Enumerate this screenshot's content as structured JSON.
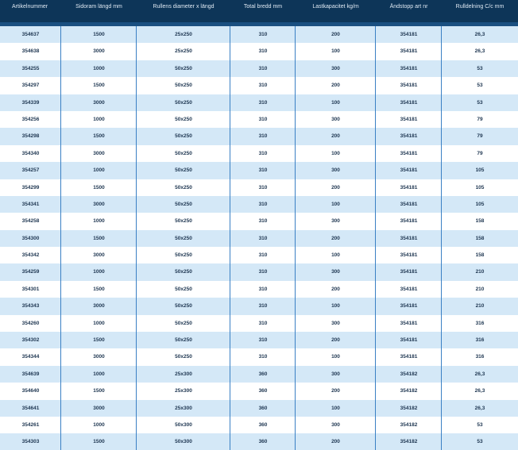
{
  "table": {
    "columns": [
      "Artikelnummer",
      "Sidoram längd mm",
      "Rullens diameter x längd",
      "Total bredd mm",
      "Lastkapacitet kg/m",
      "Ändstopp art nr",
      "Rulldelning C/c mm"
    ],
    "rows": [
      [
        "354637",
        "1500",
        "25x250",
        "310",
        "200",
        "354181",
        "26,3"
      ],
      [
        "354638",
        "3000",
        "25x250",
        "310",
        "100",
        "354181",
        "26,3"
      ],
      [
        "354255",
        "1000",
        "50x250",
        "310",
        "300",
        "354181",
        "53"
      ],
      [
        "354297",
        "1500",
        "50x250",
        "310",
        "200",
        "354181",
        "53"
      ],
      [
        "354339",
        "3000",
        "50x250",
        "310",
        "100",
        "354181",
        "53"
      ],
      [
        "354256",
        "1000",
        "50x250",
        "310",
        "300",
        "354181",
        "79"
      ],
      [
        "354298",
        "1500",
        "50x250",
        "310",
        "200",
        "354181",
        "79"
      ],
      [
        "354340",
        "3000",
        "50x250",
        "310",
        "100",
        "354181",
        "79"
      ],
      [
        "354257",
        "1000",
        "50x250",
        "310",
        "300",
        "354181",
        "105"
      ],
      [
        "354299",
        "1500",
        "50x250",
        "310",
        "200",
        "354181",
        "105"
      ],
      [
        "354341",
        "3000",
        "50x250",
        "310",
        "100",
        "354181",
        "105"
      ],
      [
        "354258",
        "1000",
        "50x250",
        "310",
        "300",
        "354181",
        "158"
      ],
      [
        "354300",
        "1500",
        "50x250",
        "310",
        "200",
        "354181",
        "158"
      ],
      [
        "354342",
        "3000",
        "50x250",
        "310",
        "100",
        "354181",
        "158"
      ],
      [
        "354259",
        "1000",
        "50x250",
        "310",
        "300",
        "354181",
        "210"
      ],
      [
        "354301",
        "1500",
        "50x250",
        "310",
        "200",
        "354181",
        "210"
      ],
      [
        "354343",
        "3000",
        "50x250",
        "310",
        "100",
        "354181",
        "210"
      ],
      [
        "354260",
        "1000",
        "50x250",
        "310",
        "300",
        "354181",
        "316"
      ],
      [
        "354302",
        "1500",
        "50x250",
        "310",
        "200",
        "354181",
        "316"
      ],
      [
        "354344",
        "3000",
        "50x250",
        "310",
        "100",
        "354181",
        "316"
      ],
      [
        "354639",
        "1000",
        "25x300",
        "360",
        "300",
        "354182",
        "26,3"
      ],
      [
        "354640",
        "1500",
        "25x300",
        "360",
        "200",
        "354182",
        "26,3"
      ],
      [
        "354641",
        "3000",
        "25x300",
        "360",
        "100",
        "354182",
        "26,3"
      ],
      [
        "354261",
        "1000",
        "50x300",
        "360",
        "300",
        "354182",
        "53"
      ],
      [
        "354303",
        "1500",
        "50x300",
        "360",
        "200",
        "354182",
        "53"
      ]
    ]
  },
  "colors": {
    "header_bg": "#0d3558",
    "row_alt_bg": "#d4e8f7",
    "divider": "#3a80c4"
  }
}
